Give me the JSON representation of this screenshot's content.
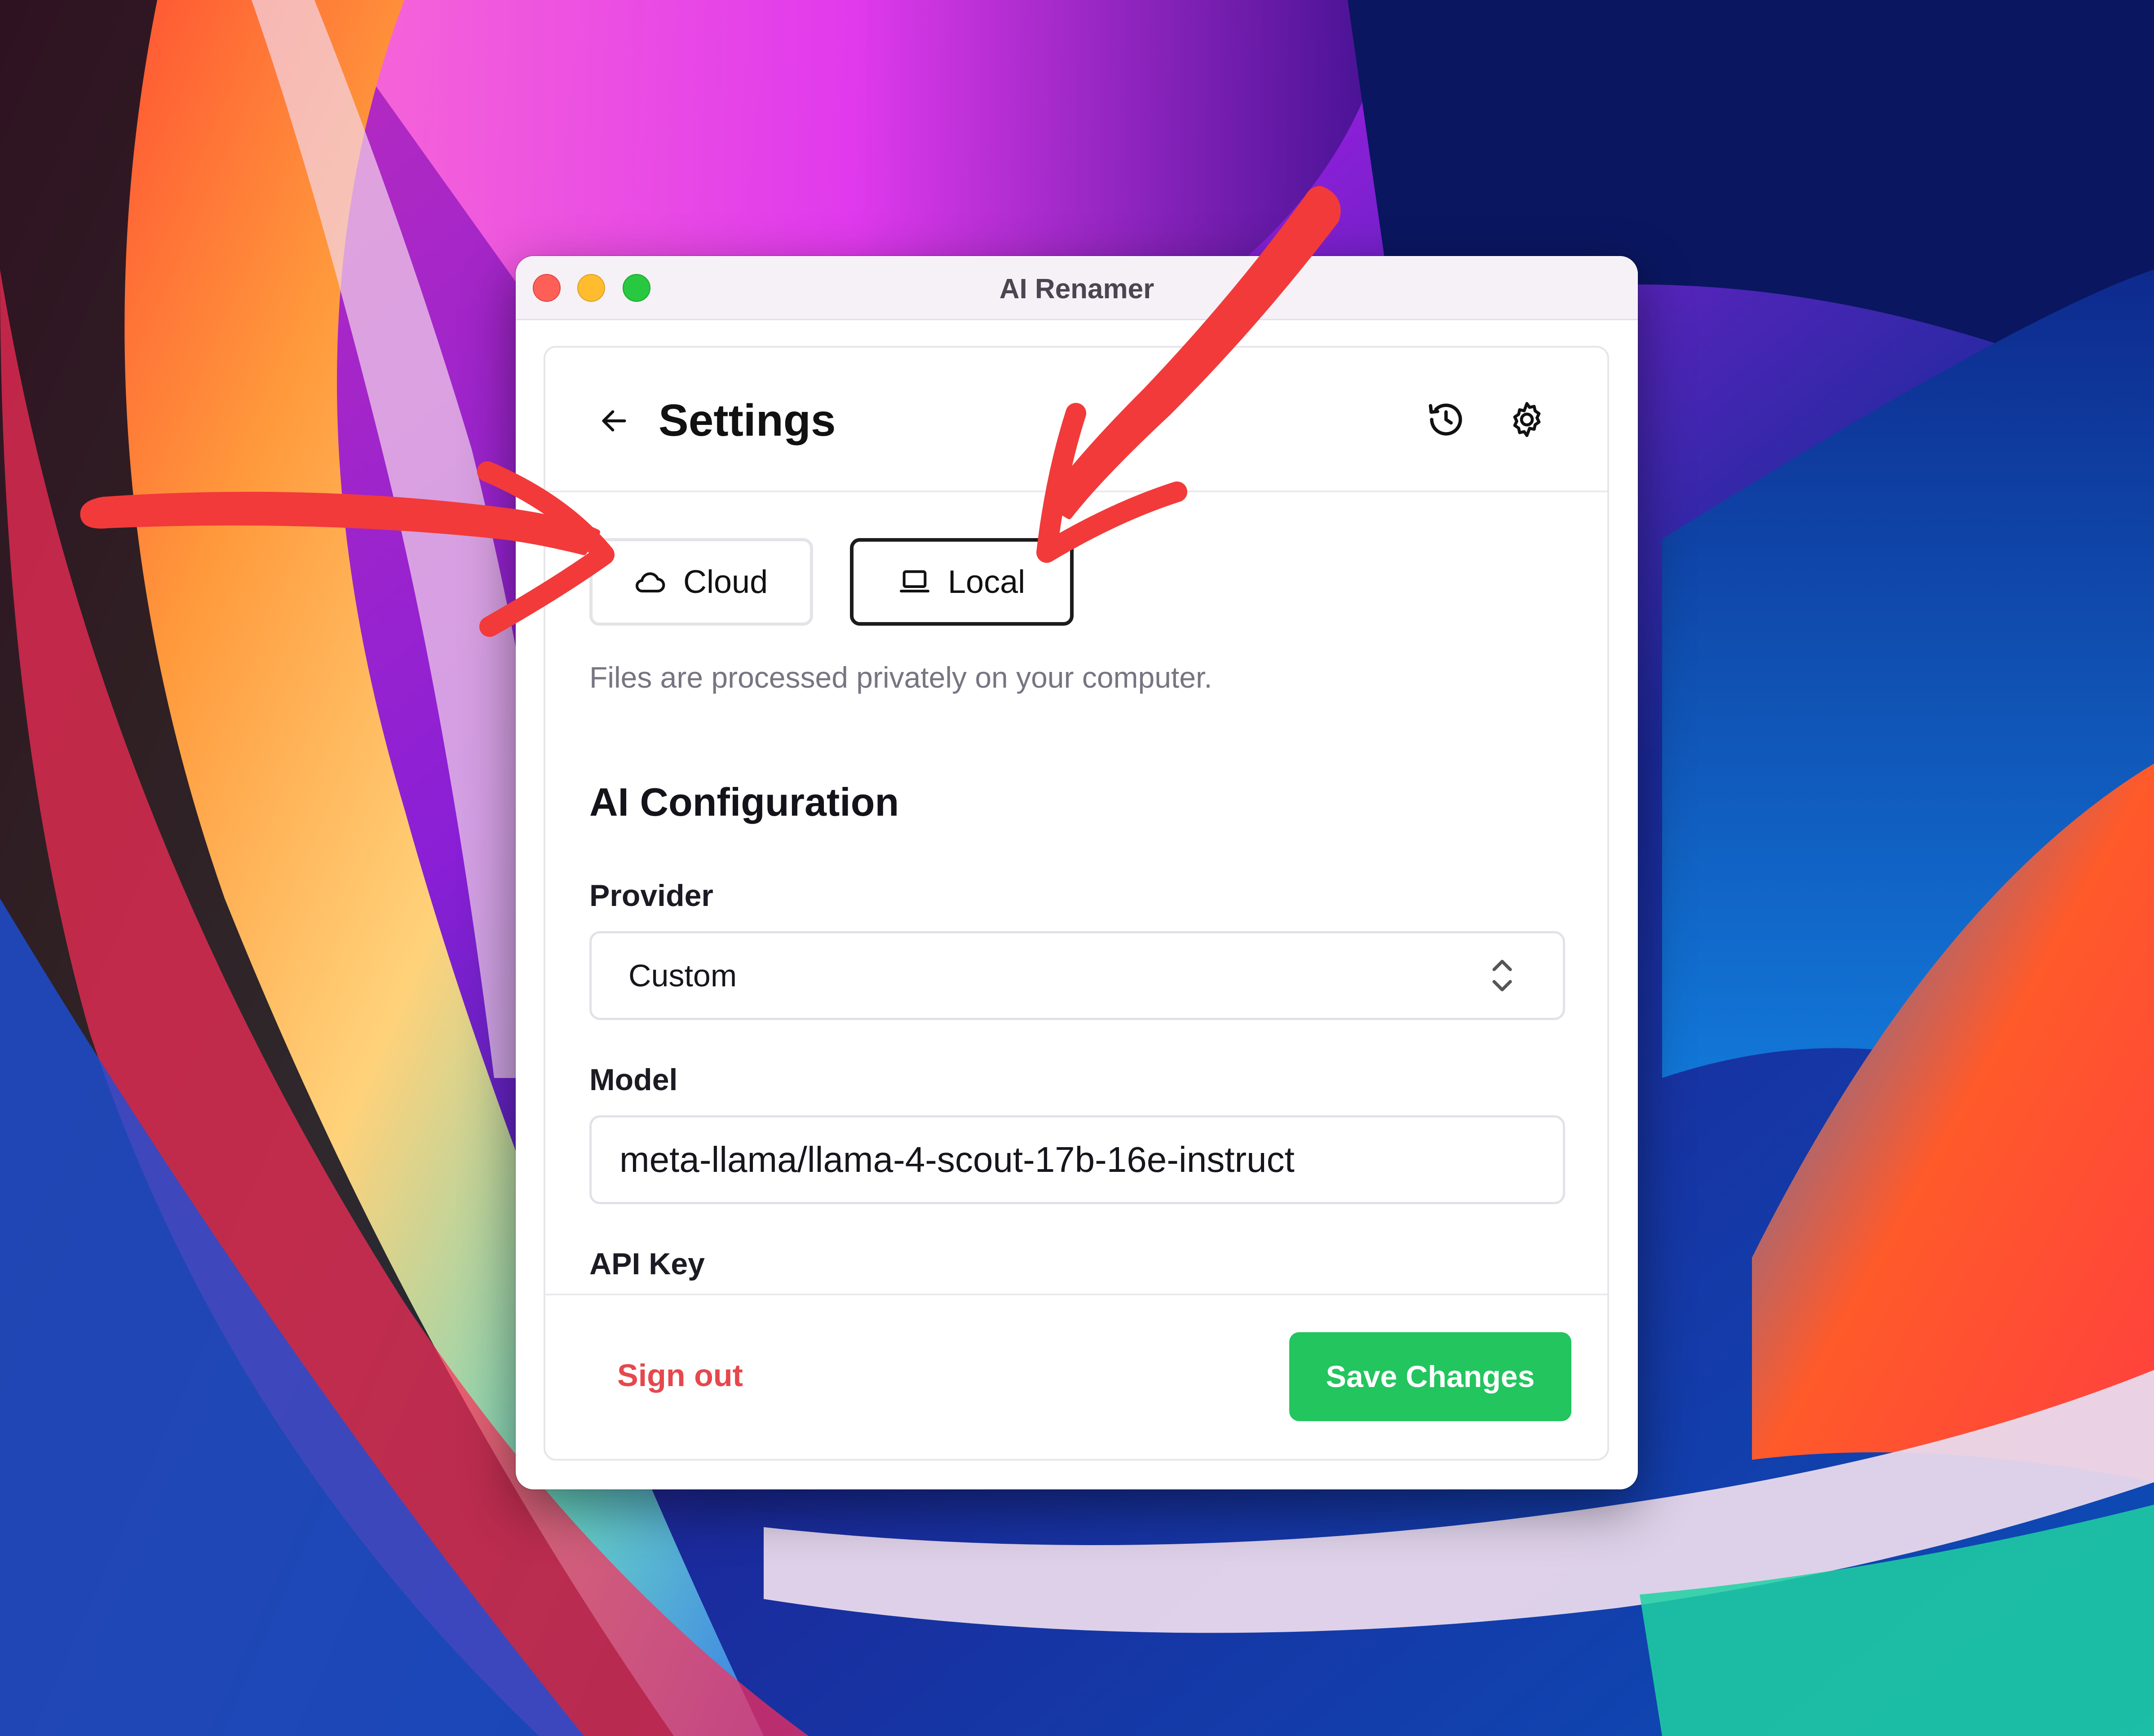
{
  "window": {
    "title": "AI Renamer"
  },
  "header": {
    "title": "Settings",
    "back_icon": "arrow-left-icon",
    "history_icon": "history-icon",
    "gear_icon": "gear-icon"
  },
  "mode": {
    "options": [
      {
        "label": "Cloud",
        "icon": "cloud-icon",
        "selected": false
      },
      {
        "label": "Local",
        "icon": "laptop-icon",
        "selected": true
      }
    ],
    "description": "Files are processed privately on your computer."
  },
  "ai_config": {
    "title": "AI Configuration",
    "provider_label": "Provider",
    "provider_value": "Custom",
    "model_label": "Model",
    "model_value": "meta-llama/llama-4-scout-17b-16e-instruct",
    "api_key_label": "API Key"
  },
  "footer": {
    "sign_out_label": "Sign out",
    "save_label": "Save Changes"
  },
  "colors": {
    "accent_green": "#22c55e",
    "danger_red": "#e5484d",
    "annotation_red": "#f23a3a"
  }
}
